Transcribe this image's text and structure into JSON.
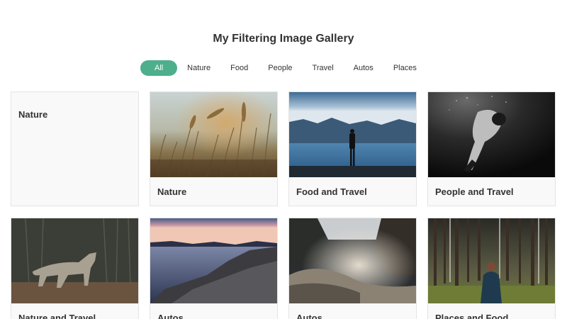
{
  "page": {
    "title": "My Filtering Image Gallery"
  },
  "filters": [
    {
      "label": "All",
      "active": true
    },
    {
      "label": "Nature"
    },
    {
      "label": "Food"
    },
    {
      "label": "People"
    },
    {
      "label": "Travel"
    },
    {
      "label": "Autos"
    },
    {
      "label": "Places"
    }
  ],
  "cards": [
    {
      "caption": "Nature",
      "image": "none"
    },
    {
      "caption": "Nature",
      "image": "wheat-field-photo"
    },
    {
      "caption": "Food and Travel",
      "image": "lake-person-photo"
    },
    {
      "caption": "People and Travel",
      "image": "underwater-person-photo"
    },
    {
      "caption": "Nature and Travel",
      "image": "wolf-photo"
    },
    {
      "caption": "Autos",
      "image": "rocky-coast-sunset-photo"
    },
    {
      "caption": "Autos",
      "image": "waterfall-mist-photo"
    },
    {
      "caption": "Places and Food",
      "image": "forest-person-photo"
    }
  ],
  "colors": {
    "accent": "#4daf8c",
    "card_bg": "#f9f9f9",
    "card_border": "#e4e4e4",
    "text": "#333333"
  }
}
